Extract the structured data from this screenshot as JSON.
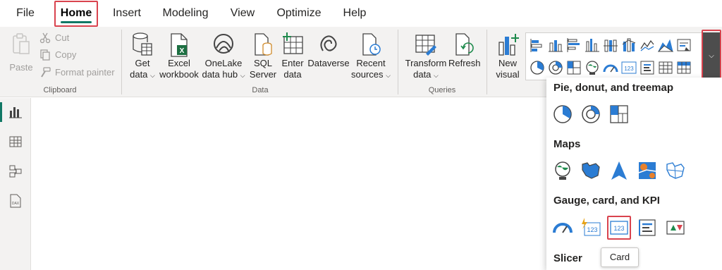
{
  "menu": {
    "tabs": [
      {
        "label": "File"
      },
      {
        "label": "Home"
      },
      {
        "label": "Insert"
      },
      {
        "label": "Modeling"
      },
      {
        "label": "View"
      },
      {
        "label": "Optimize"
      },
      {
        "label": "Help"
      }
    ],
    "active": "Home"
  },
  "clipboard": {
    "paste": "Paste",
    "cut": "Cut",
    "copy": "Copy",
    "format_painter": "Format painter",
    "label": "Clipboard"
  },
  "data_group": {
    "get_data": [
      "Get",
      "data"
    ],
    "excel": [
      "Excel",
      "workbook"
    ],
    "onelake": [
      "OneLake",
      "data hub"
    ],
    "sql": [
      "SQL",
      "Server"
    ],
    "enter_data": [
      "Enter",
      "data"
    ],
    "dataverse": "Dataverse",
    "recent": [
      "Recent",
      "sources"
    ],
    "label": "Data"
  },
  "queries": {
    "transform": [
      "Transform",
      "data"
    ],
    "refresh": "Refresh",
    "label": "Queries"
  },
  "insert": {
    "new_visual": [
      "New",
      "visual"
    ]
  },
  "panel": {
    "sections": {
      "pie": "Pie, donut, and treemap",
      "maps": "Maps",
      "gauge": "Gauge, card, and KPI",
      "slicer": "Slicer"
    },
    "tooltip": "Card"
  },
  "colors": {
    "accent": "#117865",
    "highlight": "#d9434e",
    "icon_blue": "#2b7cd3"
  }
}
